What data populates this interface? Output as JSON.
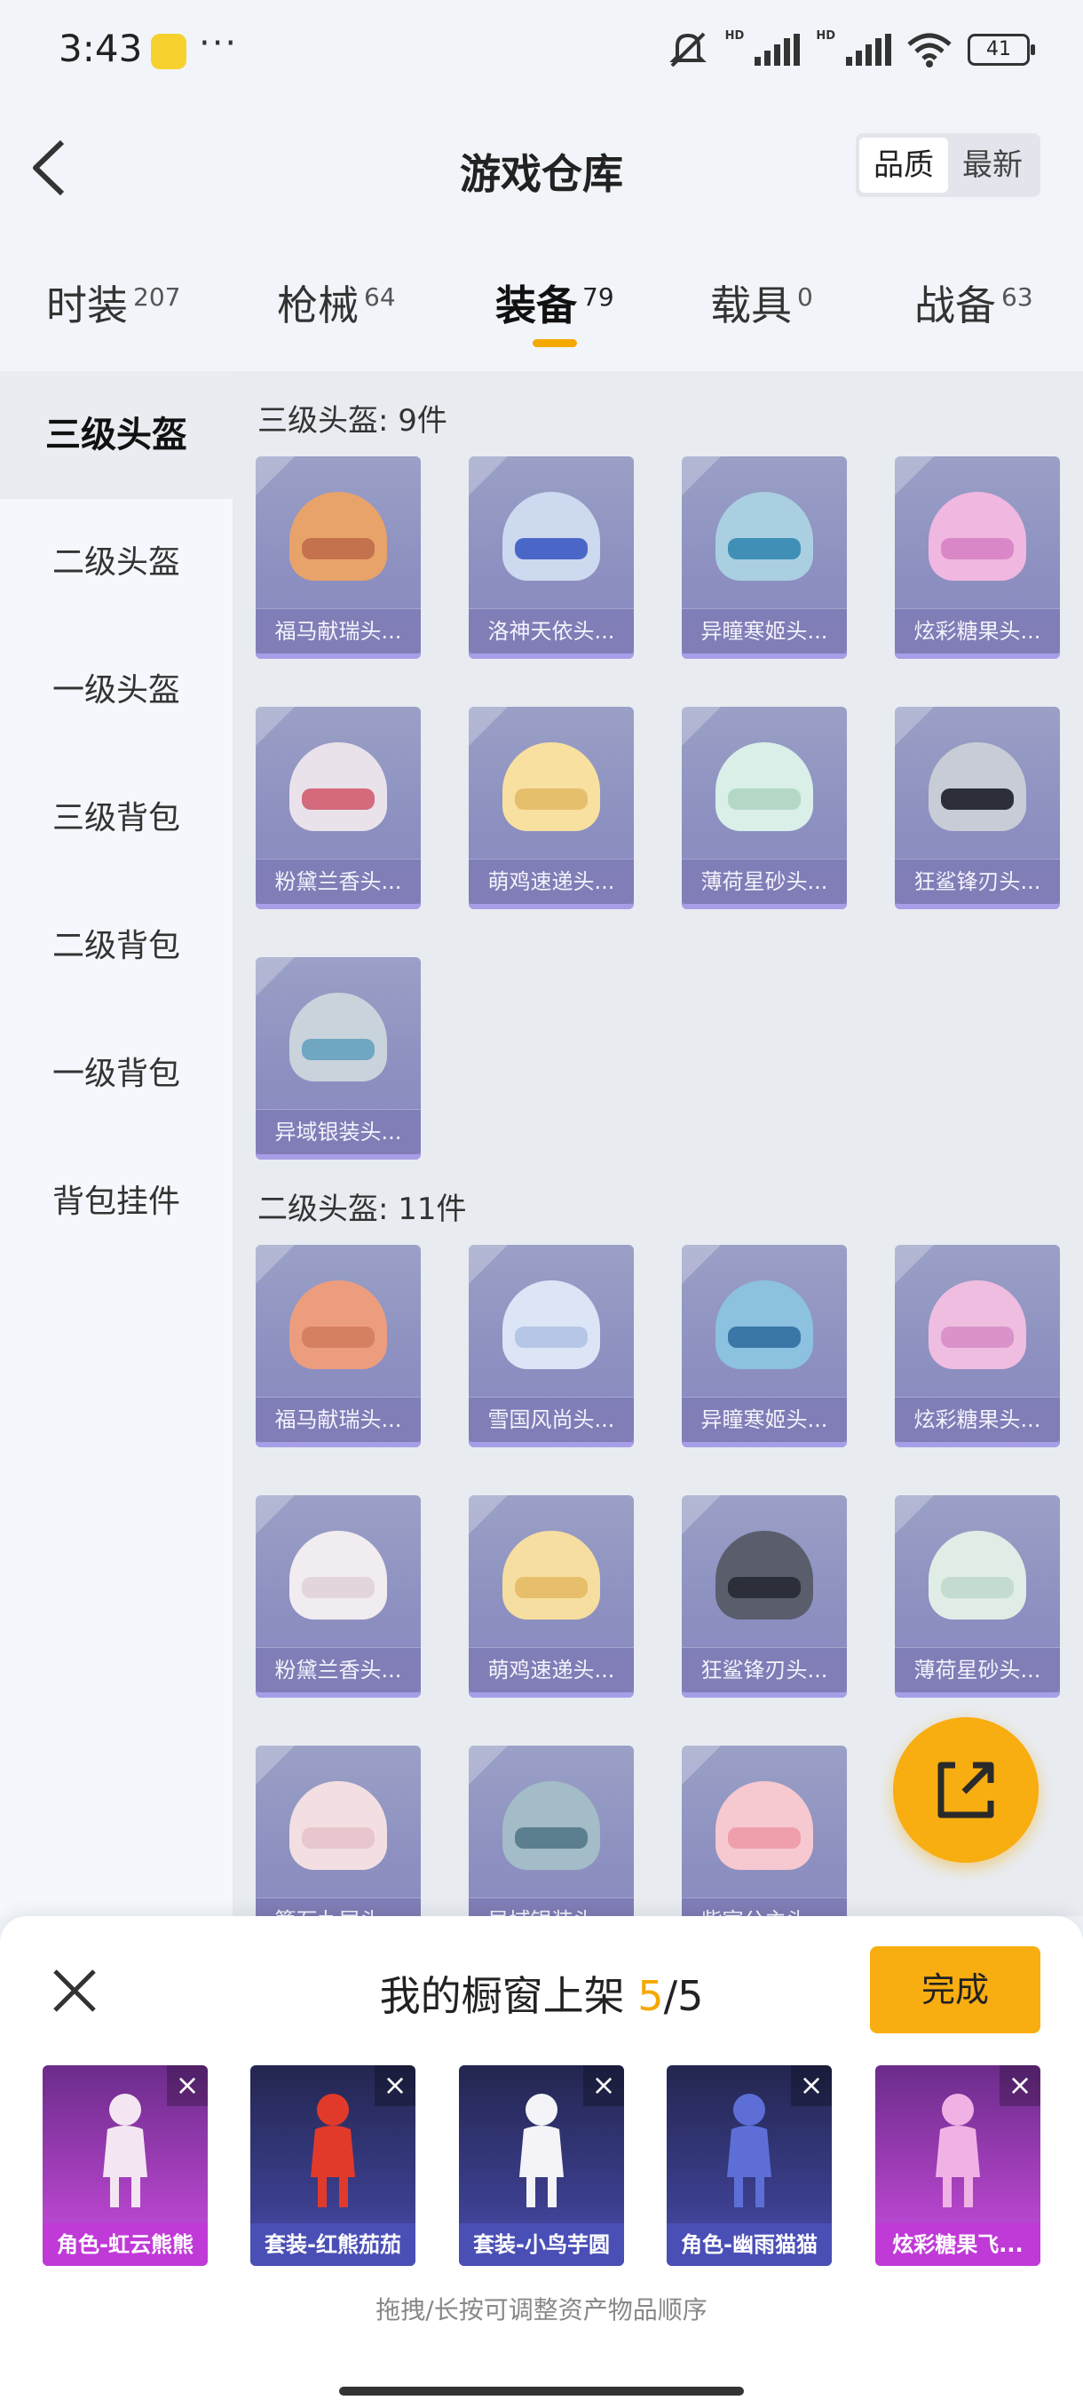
{
  "status_bar": {
    "time": "3:43",
    "battery": "41",
    "hd": "HD"
  },
  "header": {
    "title": "游戏仓库",
    "sort_options": [
      "品质",
      "最新"
    ],
    "sort_active": "品质"
  },
  "tabs": [
    {
      "label": "时装",
      "count": "207"
    },
    {
      "label": "枪械",
      "count": "64"
    },
    {
      "label": "装备",
      "count": "79",
      "active": true
    },
    {
      "label": "载具",
      "count": "0"
    },
    {
      "label": "战备",
      "count": "63"
    }
  ],
  "sidebar": {
    "items": [
      "三级头盔",
      "二级头盔",
      "一级头盔",
      "三级背包",
      "二级背包",
      "一级背包",
      "背包挂件"
    ],
    "active": "三级头盔"
  },
  "sections": [
    {
      "title": "三级头盔: 9件",
      "items": [
        {
          "label": "福马献瑞头...",
          "color": "#e8a36a",
          "visor": "#c4724d"
        },
        {
          "label": "洛神天依头...",
          "color": "#cdd9ef",
          "visor": "#4a67c8"
        },
        {
          "label": "异瞳寒姬头...",
          "color": "#a9cfe0",
          "visor": "#3f8fb6"
        },
        {
          "label": "炫彩糖果头...",
          "color": "#f0b7e0",
          "visor": "#d987c6"
        },
        {
          "label": "粉黛兰香头...",
          "color": "#e9e2ea",
          "visor": "#d46a7b"
        },
        {
          "label": "萌鸡速递头...",
          "color": "#f7e0a0",
          "visor": "#e6bf6d"
        },
        {
          "label": "薄荷星砂头...",
          "color": "#d9efe8",
          "visor": "#b3d8c6"
        },
        {
          "label": "狂鲨锋刃头...",
          "color": "#c7ccd6",
          "visor": "#2c2f3a"
        },
        {
          "label": "异域银装头...",
          "color": "#c8d3dc",
          "visor": "#6fa6c1"
        }
      ]
    },
    {
      "title": "二级头盔: 11件",
      "items": [
        {
          "label": "福马献瑞头...",
          "color": "#ec9d7e",
          "visor": "#d68062"
        },
        {
          "label": "雪国风尚头...",
          "color": "#dbe5f5",
          "visor": "#b6c6e6"
        },
        {
          "label": "异瞳寒姬头...",
          "color": "#8cc1e0",
          "visor": "#3a76a8"
        },
        {
          "label": "炫彩糖果头...",
          "color": "#efbde0",
          "visor": "#d993c9"
        },
        {
          "label": "粉黛兰香头...",
          "color": "#f1ecef",
          "visor": "#e2d6dc"
        },
        {
          "label": "萌鸡速递头...",
          "color": "#f6dea0",
          "visor": "#e7bf6c"
        },
        {
          "label": "狂鲨锋刃头...",
          "color": "#5a5e6c",
          "visor": "#2c2f3a"
        },
        {
          "label": "薄荷星砂头...",
          "color": "#e0ede6",
          "visor": "#c3dccf"
        },
        {
          "label": "篝石九尾头...",
          "color": "#f3dfe2",
          "visor": "#e7c7cd"
        },
        {
          "label": "异域银装头...",
          "color": "#a3bcc8",
          "visor": "#5b7f8f"
        },
        {
          "label": "紫宸公主头...",
          "color": "#f6c8cf",
          "visor": "#ee9fab"
        }
      ]
    }
  ],
  "showcase": {
    "title_prefix": "我的橱窗上架",
    "current": "5",
    "separator": "/",
    "total": "5",
    "done_label": "完成",
    "hint": "拖拽/长按可调整资产物品顺序",
    "items": [
      {
        "label": "角色-虹云熊熊",
        "theme": "purple",
        "fig": "#f3e6f2"
      },
      {
        "label": "套装-红熊茄茄",
        "theme": "blue",
        "fig": "#e23a2a"
      },
      {
        "label": "套装-小鸟芋圆",
        "theme": "blue",
        "fig": "#f4f4f8"
      },
      {
        "label": "角色-幽雨猫猫",
        "theme": "blue",
        "fig": "#5d6fd6"
      },
      {
        "label": "炫彩糖果飞...",
        "theme": "purple",
        "fig": "#f0b2e4"
      }
    ]
  }
}
